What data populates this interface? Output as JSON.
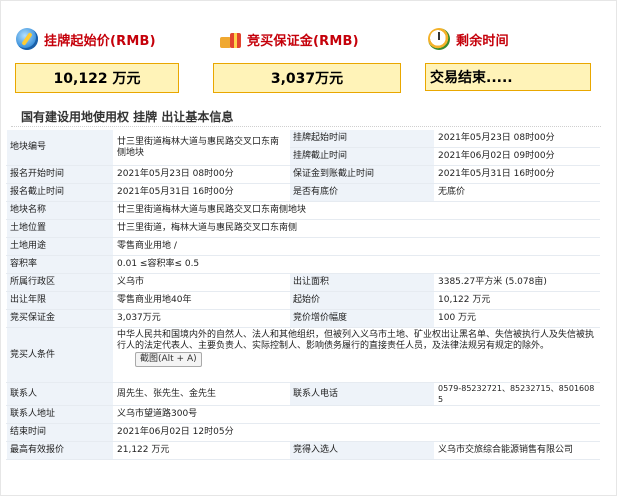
{
  "summary": {
    "start_price_label": "挂牌起始价(RMB)",
    "deposit_label": "竞买保证金(RMB)",
    "remaining_label": "剩余时间",
    "start_price_value": "10,122 万元",
    "deposit_value": "3,037万元",
    "remaining_value": "交易结束....."
  },
  "section_title": "国有建设用地使用权 挂牌 出让基本信息",
  "table": {
    "r1": {
      "l1": "地块编号",
      "v1": "廿三里街道梅林大道与惠民路交叉口东南侧地块",
      "l2a": "挂牌起始时间",
      "v2a": "2021年05月23日 08时00分",
      "l2b": "挂牌截止时间",
      "v2b": "2021年06月02日 09时00分"
    },
    "r2": {
      "l1": "报名开始时间",
      "v1": "2021年05月23日 08时00分",
      "l2": "保证金到账截止时间",
      "v2": "2021年05月31日 16时00分"
    },
    "r3": {
      "l1": "报名截止时间",
      "v1": "2021年05月31日 16时00分",
      "l2": "是否有底价",
      "v2": "无底价"
    },
    "r4": {
      "l1": "地块名称",
      "v1": "廿三里街道梅林大道与惠民路交叉口东南侧地块"
    },
    "r5": {
      "l1": "土地位置",
      "v1": "廿三里街道，梅林大道与惠民路交叉口东南侧"
    },
    "r6": {
      "l1": "土地用途",
      "v1": "零售商业用地 /"
    },
    "r7": {
      "l1": "容积率",
      "v1": "0.01 ≤容积率≤ 0.5"
    },
    "r8": {
      "l1": "所属行政区",
      "v1": "义乌市",
      "l2": "出让面积",
      "v2": "3385.27平方米 (5.078亩)"
    },
    "r9": {
      "l1": "出让年限",
      "v1": "零售商业用地40年",
      "l2": "起始价",
      "v2": "10,122 万元"
    },
    "r10": {
      "l1": "竞买保证金",
      "v1": "3,037万元",
      "l2": "竞价增价幅度",
      "v2": "100 万元"
    },
    "r11": {
      "l1": "竞买人条件",
      "v1": "中华人民共和国境内外的自然人、法人和其他组织，但被列入义乌市土地、矿业权出让黑名单、失信被执行人及失信被执行人的法定代表人、主要负责人、实际控制人、影响债务履行的直接责任人员，及法律法规另有规定的除外。",
      "tip": "截图(Alt + A)"
    },
    "r12": {
      "l1": "联系人",
      "v1": "周先生、张先生、金先生",
      "l2": "联系人电话",
      "v2": "0579-85232721、85232715、85016085"
    },
    "r13": {
      "l1": "联系人地址",
      "v1": "义乌市望道路300号"
    },
    "r14": {
      "l1": "结束时间",
      "v1": "2021年06月02日 12时05分"
    },
    "r15": {
      "l1": "最高有效报价",
      "v1": "21,122 万元",
      "l2": "竞得入选人",
      "v2": "义乌市交旅综合能源销售有限公司"
    }
  }
}
